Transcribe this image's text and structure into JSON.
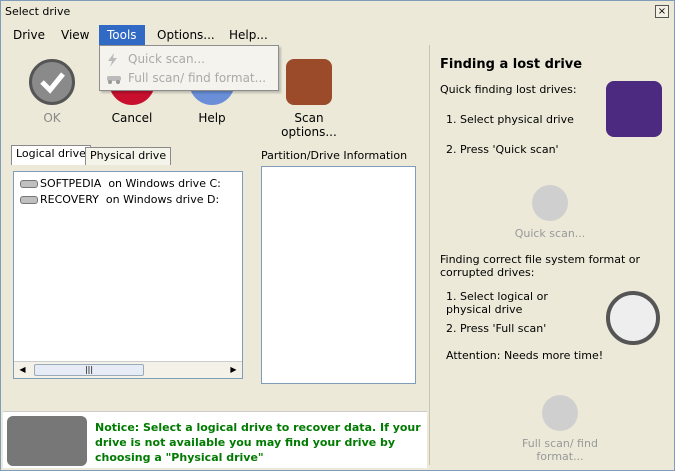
{
  "window": {
    "title": "Select drive",
    "close_glyph": "×"
  },
  "menu": {
    "items": [
      "Drive",
      "View",
      "Tools",
      "Options...",
      "Help..."
    ]
  },
  "tools_menu": {
    "quick_scan": "Quick scan...",
    "full_scan": "Full scan/ find format..."
  },
  "toolbar": {
    "ok": "OK",
    "cancel": "Cancel",
    "help": "Help",
    "scan_options": "Scan options..."
  },
  "tabs": {
    "logical": "Logical drive",
    "physical": "Physical drive"
  },
  "drives": [
    {
      "name": "SOFTPEDIA",
      "location": "on Windows drive C:"
    },
    {
      "name": "RECOVERY",
      "location": "on Windows drive D:"
    }
  ],
  "partition_label": "Partition/Drive Information",
  "right_panel": {
    "title": "Finding a lost drive",
    "quick_heading": "Quick finding lost drives:",
    "quick_step1": "1. Select physical drive",
    "quick_step2": "2. Press 'Quick scan'",
    "quick_button": "Quick scan...",
    "full_heading": "Finding correct file system format or corrupted drives:",
    "full_step1": "1. Select logical or physical drive",
    "full_step2": "2. Press 'Full scan'",
    "attention": "Attention: Needs more time!",
    "full_button": "Full scan/ find format..."
  },
  "notice": "Notice: Select a logical  drive to recover data. If your drive is not available you may find your drive by choosing a \"Physical drive\""
}
